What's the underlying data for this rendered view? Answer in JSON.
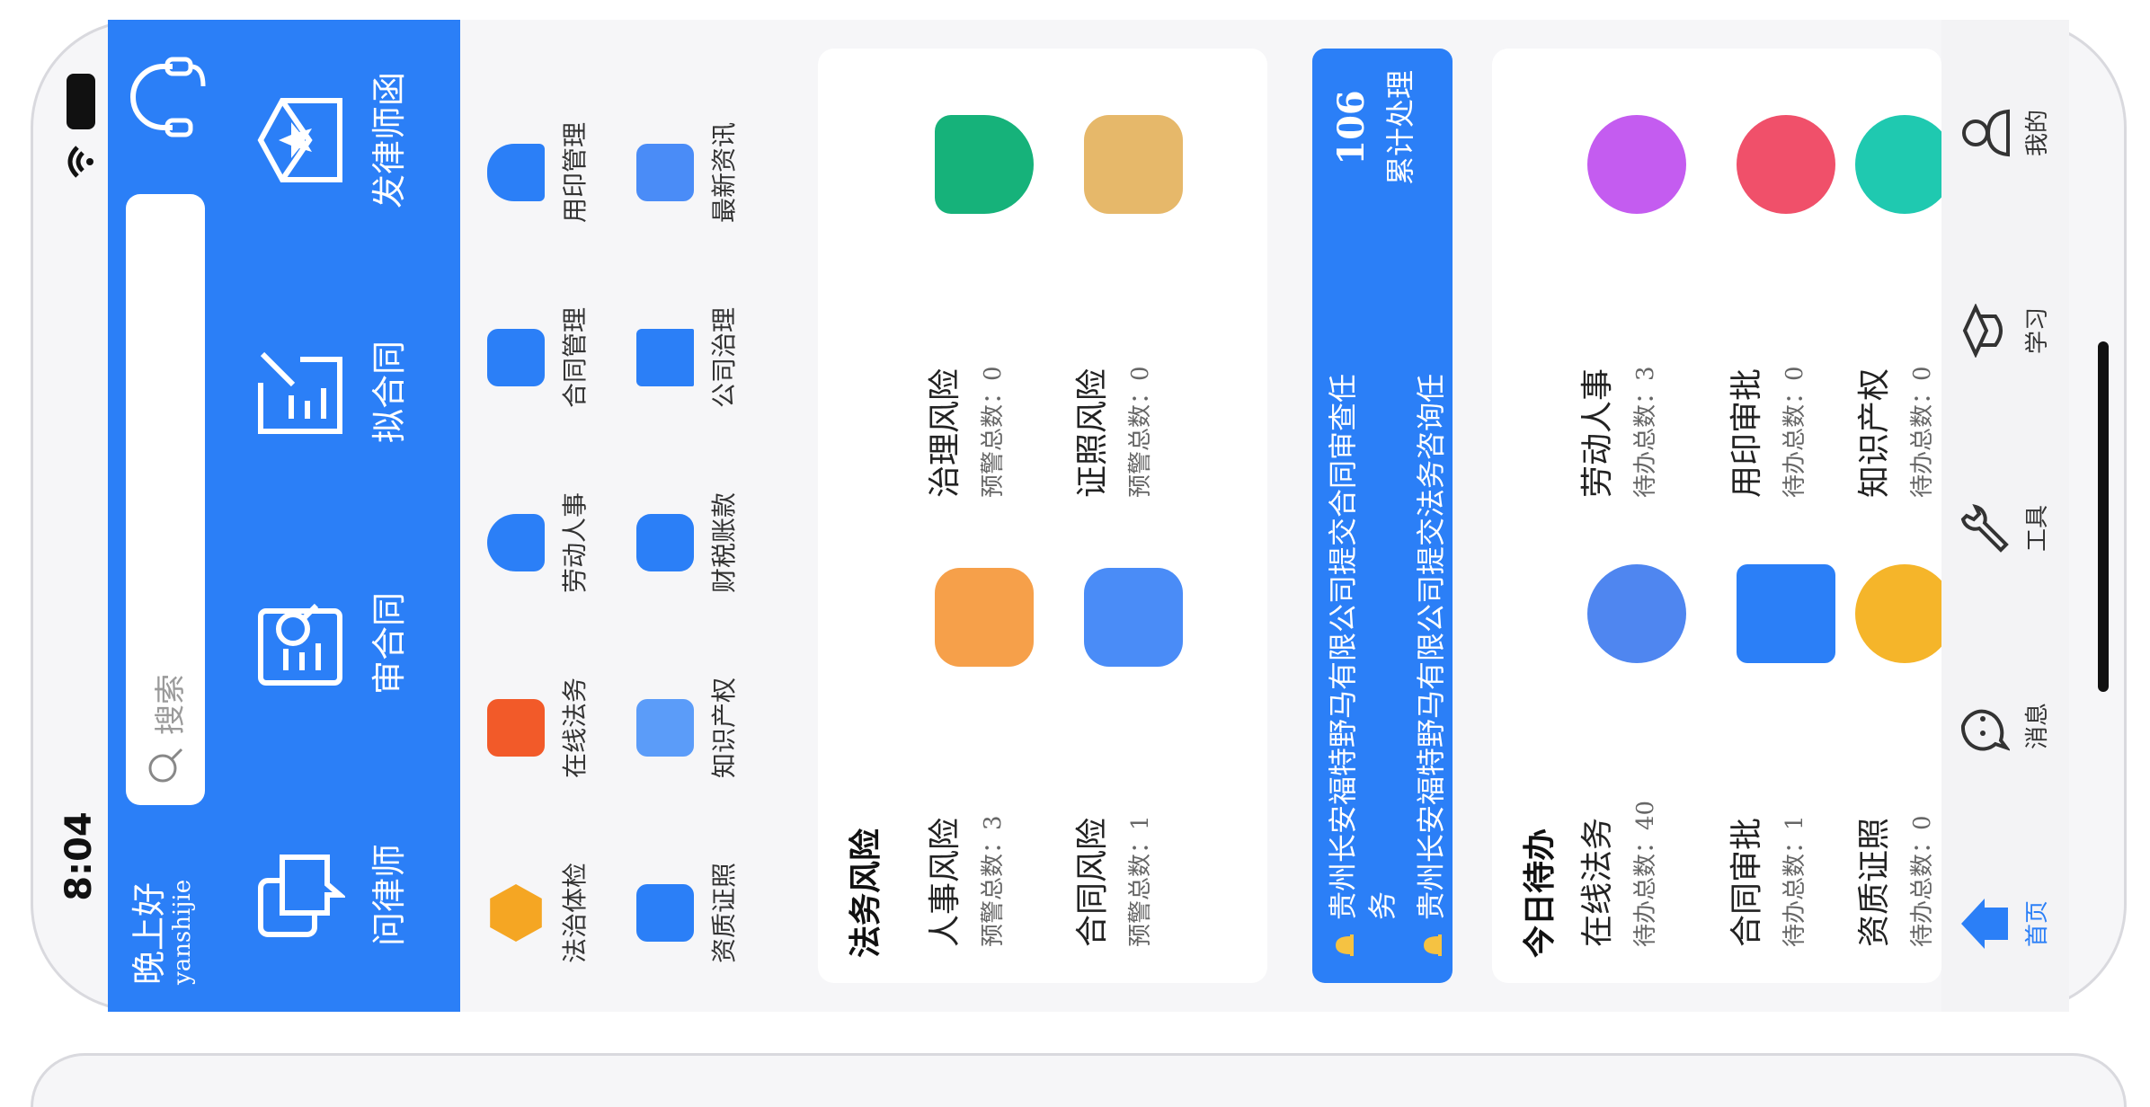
{
  "status": {
    "time": "8:04"
  },
  "header": {
    "greeting": "晚上好",
    "username": "yanshijie",
    "search_placeholder": "搜索",
    "quick_actions": [
      {
        "label": "问律师",
        "icon": "chat-bubbles-icon"
      },
      {
        "label": "审合同",
        "icon": "document-search-icon"
      },
      {
        "label": "拟合同",
        "icon": "document-edit-icon"
      },
      {
        "label": "发律师函",
        "icon": "star-letter-icon"
      }
    ]
  },
  "features": [
    {
      "label": "法治体检",
      "color": "#f5a623"
    },
    {
      "label": "在线法务",
      "color": "#f25a29"
    },
    {
      "label": "劳动人事",
      "color": "#2b7ff7"
    },
    {
      "label": "合同管理",
      "color": "#2b7ff7"
    },
    {
      "label": "用印管理",
      "color": "#2b7ff7"
    },
    {
      "label": "资质证照",
      "color": "#2b7ff7"
    },
    {
      "label": "知识产权",
      "color": "#2b7ff7"
    },
    {
      "label": "财税账款",
      "color": "#2b7ff7"
    },
    {
      "label": "公司治理",
      "color": "#2b7ff7"
    },
    {
      "label": "最新资讯",
      "color": "#2b7ff7"
    }
  ],
  "legal_risk": {
    "title": "法务风险",
    "items": [
      {
        "name": "人事风险",
        "stat": "预警总数：3",
        "color": "#f6a04a"
      },
      {
        "name": "治理风险",
        "stat": "预警总数：0",
        "color": "#16b27a"
      },
      {
        "name": "合同风险",
        "stat": "预警总数：1",
        "color": "#4a8cf7"
      },
      {
        "name": "证照风险",
        "stat": "预警总数：0",
        "color": "#e6b86a"
      }
    ]
  },
  "notice": {
    "line1": "贵州长安福特野马有限公司提交合同审查任",
    "line1b": "务",
    "line2": "贵州长安福特野马有限公司提交法务咨询任",
    "total_value": "106",
    "total_label": "累计处理"
  },
  "todo": {
    "title": "今日待办",
    "items": [
      {
        "name": "在线法务",
        "stat": "待办总数：40",
        "color": "#4f86f0"
      },
      {
        "name": "劳动人事",
        "stat": "待办总数：3",
        "color": "#c45cf0"
      },
      {
        "name": "合同审批",
        "stat": "待办总数：1",
        "color": "#2b7ff7"
      },
      {
        "name": "用印审批",
        "stat": "待办总数：0",
        "color": "#f0506a"
      },
      {
        "name": "资质证照",
        "stat": "待办总数：0",
        "color": "#f5b52a"
      },
      {
        "name": "知识产权",
        "stat": "待办总数：0",
        "color": "#1fc9b0"
      }
    ]
  },
  "tabs": [
    {
      "label": "首页",
      "active": true
    },
    {
      "label": "消息"
    },
    {
      "label": "工具"
    },
    {
      "label": "学习"
    },
    {
      "label": "我的"
    }
  ],
  "colors": {
    "primary": "#2b7ff7",
    "background": "#f6f6f8"
  }
}
